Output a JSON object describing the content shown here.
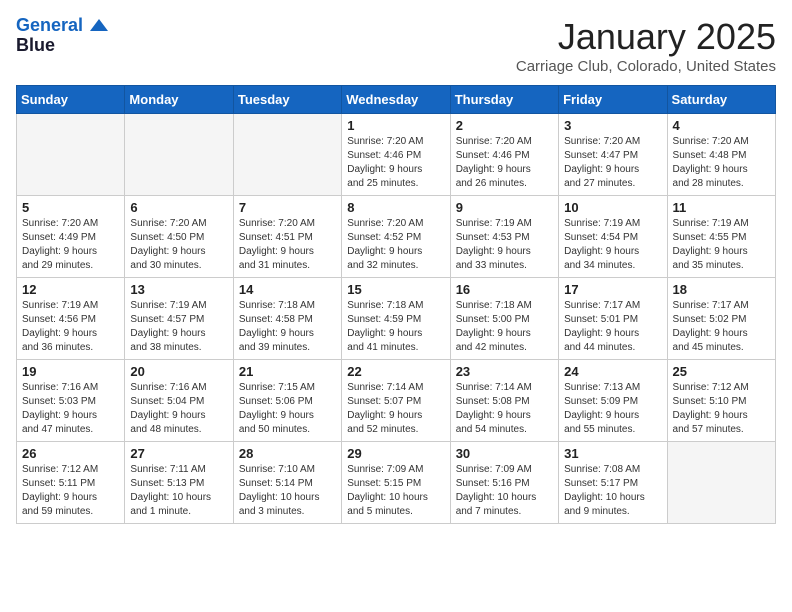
{
  "header": {
    "logo_line1": "General",
    "logo_line2": "Blue",
    "month": "January 2025",
    "location": "Carriage Club, Colorado, United States"
  },
  "weekdays": [
    "Sunday",
    "Monday",
    "Tuesday",
    "Wednesday",
    "Thursday",
    "Friday",
    "Saturday"
  ],
  "weeks": [
    [
      {
        "day": "",
        "info": ""
      },
      {
        "day": "",
        "info": ""
      },
      {
        "day": "",
        "info": ""
      },
      {
        "day": "1",
        "info": "Sunrise: 7:20 AM\nSunset: 4:46 PM\nDaylight: 9 hours\nand 25 minutes."
      },
      {
        "day": "2",
        "info": "Sunrise: 7:20 AM\nSunset: 4:46 PM\nDaylight: 9 hours\nand 26 minutes."
      },
      {
        "day": "3",
        "info": "Sunrise: 7:20 AM\nSunset: 4:47 PM\nDaylight: 9 hours\nand 27 minutes."
      },
      {
        "day": "4",
        "info": "Sunrise: 7:20 AM\nSunset: 4:48 PM\nDaylight: 9 hours\nand 28 minutes."
      }
    ],
    [
      {
        "day": "5",
        "info": "Sunrise: 7:20 AM\nSunset: 4:49 PM\nDaylight: 9 hours\nand 29 minutes."
      },
      {
        "day": "6",
        "info": "Sunrise: 7:20 AM\nSunset: 4:50 PM\nDaylight: 9 hours\nand 30 minutes."
      },
      {
        "day": "7",
        "info": "Sunrise: 7:20 AM\nSunset: 4:51 PM\nDaylight: 9 hours\nand 31 minutes."
      },
      {
        "day": "8",
        "info": "Sunrise: 7:20 AM\nSunset: 4:52 PM\nDaylight: 9 hours\nand 32 minutes."
      },
      {
        "day": "9",
        "info": "Sunrise: 7:19 AM\nSunset: 4:53 PM\nDaylight: 9 hours\nand 33 minutes."
      },
      {
        "day": "10",
        "info": "Sunrise: 7:19 AM\nSunset: 4:54 PM\nDaylight: 9 hours\nand 34 minutes."
      },
      {
        "day": "11",
        "info": "Sunrise: 7:19 AM\nSunset: 4:55 PM\nDaylight: 9 hours\nand 35 minutes."
      }
    ],
    [
      {
        "day": "12",
        "info": "Sunrise: 7:19 AM\nSunset: 4:56 PM\nDaylight: 9 hours\nand 36 minutes."
      },
      {
        "day": "13",
        "info": "Sunrise: 7:19 AM\nSunset: 4:57 PM\nDaylight: 9 hours\nand 38 minutes."
      },
      {
        "day": "14",
        "info": "Sunrise: 7:18 AM\nSunset: 4:58 PM\nDaylight: 9 hours\nand 39 minutes."
      },
      {
        "day": "15",
        "info": "Sunrise: 7:18 AM\nSunset: 4:59 PM\nDaylight: 9 hours\nand 41 minutes."
      },
      {
        "day": "16",
        "info": "Sunrise: 7:18 AM\nSunset: 5:00 PM\nDaylight: 9 hours\nand 42 minutes."
      },
      {
        "day": "17",
        "info": "Sunrise: 7:17 AM\nSunset: 5:01 PM\nDaylight: 9 hours\nand 44 minutes."
      },
      {
        "day": "18",
        "info": "Sunrise: 7:17 AM\nSunset: 5:02 PM\nDaylight: 9 hours\nand 45 minutes."
      }
    ],
    [
      {
        "day": "19",
        "info": "Sunrise: 7:16 AM\nSunset: 5:03 PM\nDaylight: 9 hours\nand 47 minutes."
      },
      {
        "day": "20",
        "info": "Sunrise: 7:16 AM\nSunset: 5:04 PM\nDaylight: 9 hours\nand 48 minutes."
      },
      {
        "day": "21",
        "info": "Sunrise: 7:15 AM\nSunset: 5:06 PM\nDaylight: 9 hours\nand 50 minutes."
      },
      {
        "day": "22",
        "info": "Sunrise: 7:14 AM\nSunset: 5:07 PM\nDaylight: 9 hours\nand 52 minutes."
      },
      {
        "day": "23",
        "info": "Sunrise: 7:14 AM\nSunset: 5:08 PM\nDaylight: 9 hours\nand 54 minutes."
      },
      {
        "day": "24",
        "info": "Sunrise: 7:13 AM\nSunset: 5:09 PM\nDaylight: 9 hours\nand 55 minutes."
      },
      {
        "day": "25",
        "info": "Sunrise: 7:12 AM\nSunset: 5:10 PM\nDaylight: 9 hours\nand 57 minutes."
      }
    ],
    [
      {
        "day": "26",
        "info": "Sunrise: 7:12 AM\nSunset: 5:11 PM\nDaylight: 9 hours\nand 59 minutes."
      },
      {
        "day": "27",
        "info": "Sunrise: 7:11 AM\nSunset: 5:13 PM\nDaylight: 10 hours\nand 1 minute."
      },
      {
        "day": "28",
        "info": "Sunrise: 7:10 AM\nSunset: 5:14 PM\nDaylight: 10 hours\nand 3 minutes."
      },
      {
        "day": "29",
        "info": "Sunrise: 7:09 AM\nSunset: 5:15 PM\nDaylight: 10 hours\nand 5 minutes."
      },
      {
        "day": "30",
        "info": "Sunrise: 7:09 AM\nSunset: 5:16 PM\nDaylight: 10 hours\nand 7 minutes."
      },
      {
        "day": "31",
        "info": "Sunrise: 7:08 AM\nSunset: 5:17 PM\nDaylight: 10 hours\nand 9 minutes."
      },
      {
        "day": "",
        "info": ""
      }
    ]
  ]
}
